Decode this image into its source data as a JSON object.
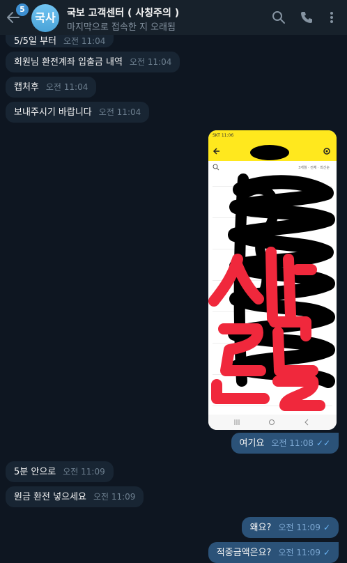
{
  "header": {
    "unread_count": "5",
    "avatar_initials": "국사",
    "title": "국보 고객센터 ( 사칭주의 )",
    "subtitle": "마지막으로 접속한 지 오래됨",
    "icons": [
      "back-arrow-icon",
      "search-icon",
      "phone-icon",
      "more-vertical-icon"
    ]
  },
  "messages": [
    {
      "dir": "in",
      "text": "5/5일 부터",
      "time": "오전 11:04"
    },
    {
      "dir": "in",
      "text": "회원님 환전계좌 입출금 내역",
      "time": "오전 11:04"
    },
    {
      "dir": "in",
      "text": "캡처후",
      "time": "오전 11:04"
    },
    {
      "dir": "in",
      "text": "보내주시기 바랍니다",
      "time": "오전 11:04"
    },
    {
      "dir": "out",
      "text": "여기요",
      "time": "오전 11:08",
      "read": true
    },
    {
      "dir": "in",
      "text": "5분 안으로",
      "time": "오전 11:09"
    },
    {
      "dir": "in",
      "text": "원금 환전 넣으세요",
      "time": "오전 11:09"
    },
    {
      "dir": "out",
      "text": "왜요?",
      "time": "오전 11:09",
      "read": false
    },
    {
      "dir": "out",
      "text": "적중금액은요?",
      "time": "오전 11:09",
      "read": false
    }
  ],
  "photo": {
    "status_time": "SKT 11:06",
    "filter_label": "3개월 · 전체 · 최신순",
    "overlay_text": "사칭",
    "overlay_color": "#f0283c",
    "scribble_color": "#000000",
    "accent_color": "#ffe81e"
  }
}
